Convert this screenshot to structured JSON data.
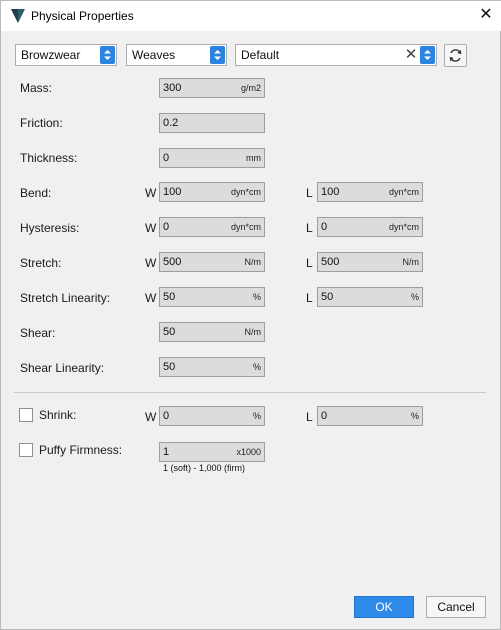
{
  "window": {
    "title": "Physical Properties"
  },
  "toolbar": {
    "library": "Browzwear",
    "category": "Weaves",
    "preset": "Default",
    "icons": {
      "app": "app-logo-icon",
      "close": "close-icon",
      "clear": "clear-x-icon",
      "spin": "spin-arrows-icon",
      "refresh": "refresh-icon"
    }
  },
  "properties": {
    "mass": {
      "label": "Mass:",
      "value": "300",
      "unit": "g/m2"
    },
    "friction": {
      "label": "Friction:",
      "value": "0.2"
    },
    "thickness": {
      "label": "Thickness:",
      "value": "0",
      "unit": "mm"
    },
    "bend": {
      "label": "Bend:",
      "w_label": "W",
      "w_value": "100",
      "w_unit": "dyn*cm",
      "l_label": "L",
      "l_value": "100",
      "l_unit": "dyn*cm"
    },
    "hysteresis": {
      "label": "Hysteresis:",
      "w_label": "W",
      "w_value": "0",
      "w_unit": "dyn*cm",
      "l_label": "L",
      "l_value": "0",
      "l_unit": "dyn*cm"
    },
    "stretch": {
      "label": "Stretch:",
      "w_label": "W",
      "w_value": "500",
      "w_unit": "N/m",
      "l_label": "L",
      "l_value": "500",
      "l_unit": "N/m"
    },
    "stretch_linearity": {
      "label": "Stretch Linearity:",
      "w_label": "W",
      "w_value": "50",
      "w_unit": "%",
      "l_label": "L",
      "l_value": "50",
      "l_unit": "%"
    },
    "shear": {
      "label": "Shear:",
      "value": "50",
      "unit": "N/m"
    },
    "shear_linearity": {
      "label": "Shear Linearity:",
      "value": "50",
      "unit": "%"
    }
  },
  "shrink": {
    "label": "Shrink:",
    "checked": false,
    "w_label": "W",
    "w_value": "0",
    "w_unit": "%",
    "l_label": "L",
    "l_value": "0",
    "l_unit": "%"
  },
  "puffy": {
    "label": "Puffy Firmness:",
    "checked": false,
    "value": "1",
    "unit": "x1000",
    "hint": "1 (soft) - 1,000 (firm)"
  },
  "buttons": {
    "ok": "OK",
    "cancel": "Cancel"
  },
  "colors": {
    "accent": "#2d8ae8",
    "field_bg": "#dcdcdc",
    "window_bg": "#f0f0f0"
  }
}
